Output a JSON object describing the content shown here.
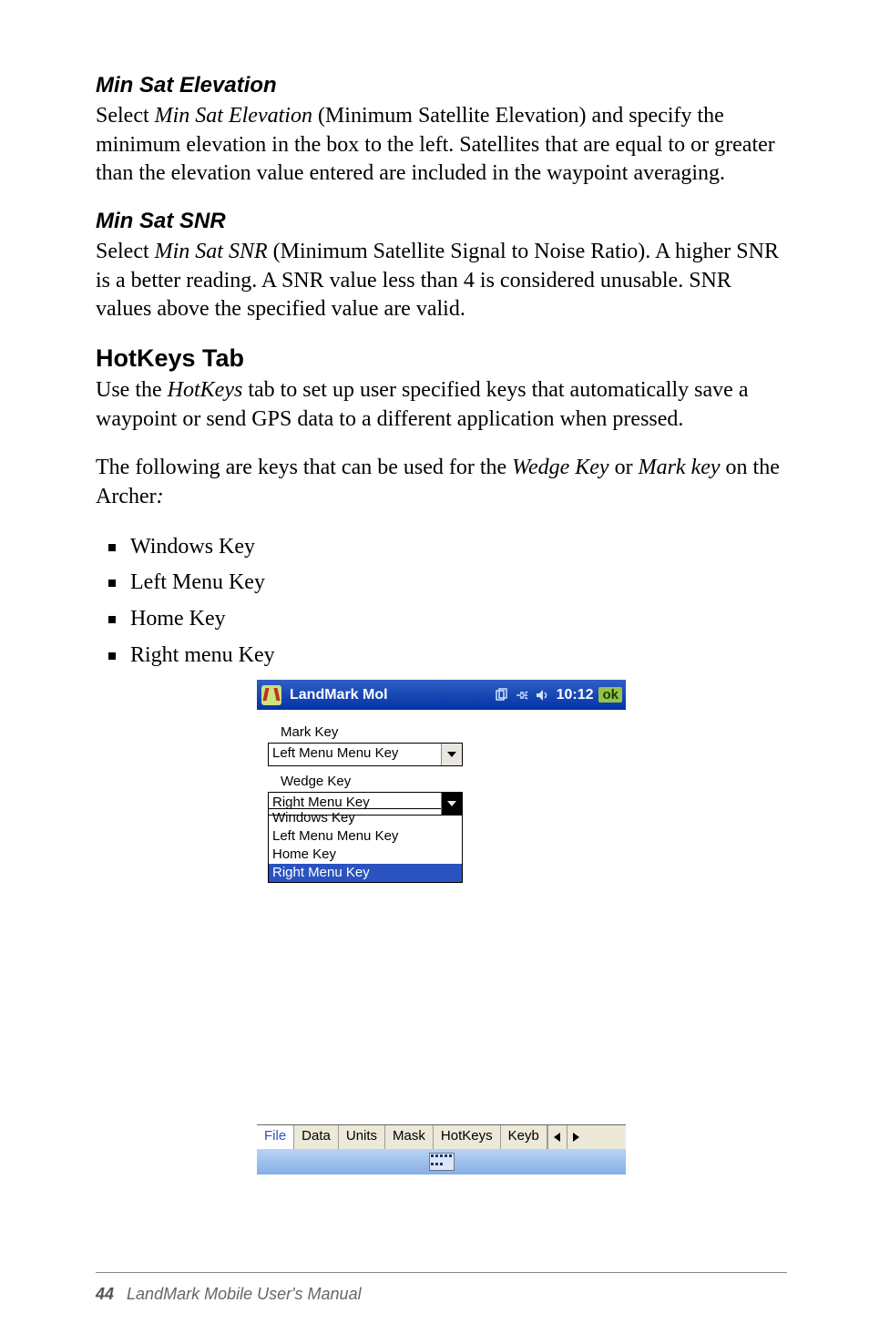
{
  "headings": {
    "minSatElevation": "Min Sat Elevation",
    "minSatSnr": "Min Sat SNR",
    "hotkeysTab": "HotKeys Tab"
  },
  "paragraphs": {
    "elevation_pre": "Select ",
    "elevation_em": "Min Sat Elevation",
    "elevation_post": " (Minimum Satellite Elevation) and specify the minimum elevation in the box to the left. Satellites that are equal to or greater than the elevation value entered are included in the waypoint averaging.",
    "snr_pre": "Select ",
    "snr_em": "Min Sat SNR",
    "snr_post": " (Minimum Satellite Signal to Noise Ratio). A higher SNR is a better reading. A SNR value less than 4 is considered unusable. SNR values above the specified value are valid.",
    "hk_pre": "Use the ",
    "hk_em": "HotKeys",
    "hk_post": " tab to set up user specified keys that automatically save a waypoint or send GPS data to a different application when pressed.",
    "keys_pre": "The following are keys that can be used for the ",
    "keys_em1": "Wedge Key",
    "keys_mid": " or ",
    "keys_em2": "Mark key",
    "keys_post1": " on the Archer",
    "keys_colon": ":"
  },
  "list": {
    "k1": "Windows Key",
    "k2": "Left Menu Key",
    "k3": "Home Key",
    "k4": "Right menu Key"
  },
  "device": {
    "title": "LandMark Mol",
    "time": "10:12",
    "ok": "ok",
    "labels": {
      "mark": "Mark Key",
      "wedge": "Wedge Key"
    },
    "selects": {
      "mark": "Left Menu Menu Key",
      "wedge": "Right Menu Key"
    },
    "options": {
      "o1": "Windows Key",
      "o2": "Left Menu Menu Key",
      "o3": "Home Key",
      "o4": "Right Menu Key"
    },
    "tabs": {
      "t1": "File",
      "t2": "Data",
      "t3": "Units",
      "t4": "Mask",
      "t5": "HotKeys",
      "t6": "Keyb"
    }
  },
  "footer": {
    "page": "44",
    "title": "LandMark Mobile User's Manual"
  }
}
